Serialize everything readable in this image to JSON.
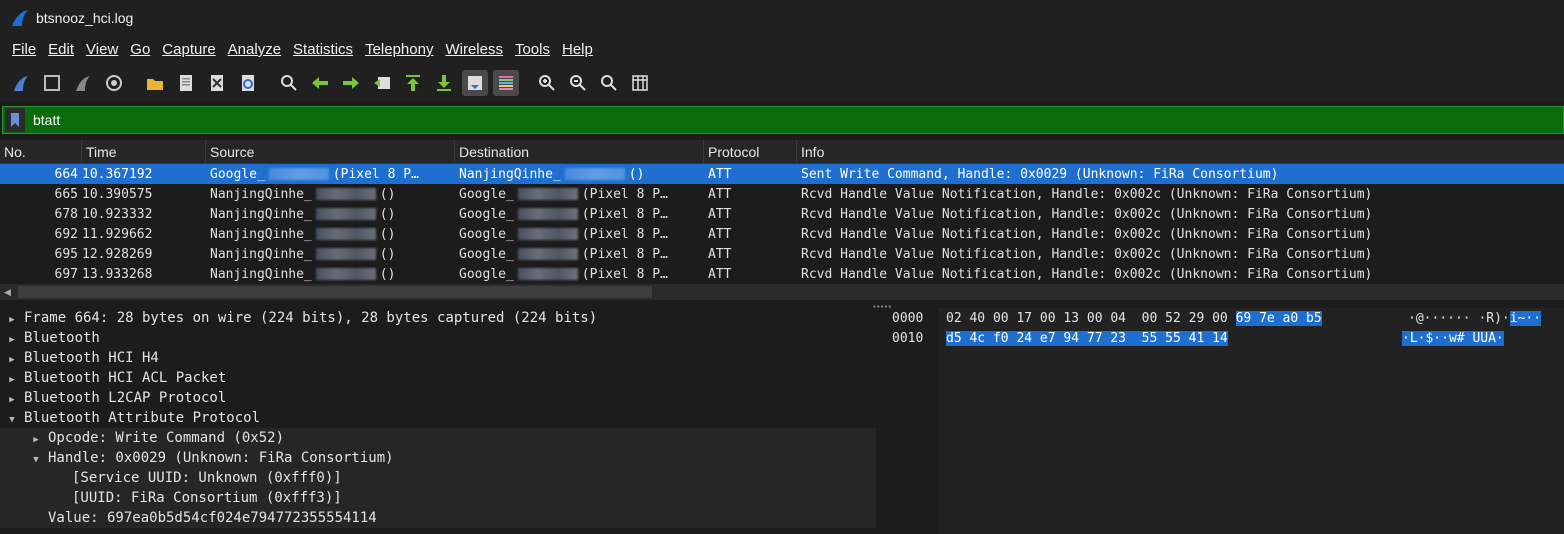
{
  "window": {
    "title": "btsnooz_hci.log"
  },
  "menu": [
    "File",
    "Edit",
    "View",
    "Go",
    "Capture",
    "Analyze",
    "Statistics",
    "Telephony",
    "Wireless",
    "Tools",
    "Help"
  ],
  "filter": {
    "value": "btatt"
  },
  "packet_list": {
    "headers": {
      "no": "No.",
      "time": "Time",
      "source": "Source",
      "destination": "Destination",
      "protocol": "Protocol",
      "info": "Info"
    },
    "rows": [
      {
        "no": "664",
        "time": "10.367192",
        "src_a": "Google_",
        "src_b": "(Pixel 8 P…",
        "dst_a": "NanjingQinhe_",
        "dst_b": "()",
        "proto": "ATT",
        "info": "Sent Write Command, Handle: 0x0029 (Unknown: FiRa Consortium)",
        "selected": true
      },
      {
        "no": "665",
        "time": "10.390575",
        "src_a": "NanjingQinhe_",
        "src_b": "()",
        "dst_a": "Google_",
        "dst_b": "(Pixel 8 P…",
        "proto": "ATT",
        "info": "Rcvd Handle Value Notification, Handle: 0x002c (Unknown: FiRa Consortium)",
        "selected": false
      },
      {
        "no": "678",
        "time": "10.923332",
        "src_a": "NanjingQinhe_",
        "src_b": "()",
        "dst_a": "Google_",
        "dst_b": "(Pixel 8 P…",
        "proto": "ATT",
        "info": "Rcvd Handle Value Notification, Handle: 0x002c (Unknown: FiRa Consortium)",
        "selected": false
      },
      {
        "no": "692",
        "time": "11.929662",
        "src_a": "NanjingQinhe_",
        "src_b": "()",
        "dst_a": "Google_",
        "dst_b": "(Pixel 8 P…",
        "proto": "ATT",
        "info": "Rcvd Handle Value Notification, Handle: 0x002c (Unknown: FiRa Consortium)",
        "selected": false
      },
      {
        "no": "695",
        "time": "12.928269",
        "src_a": "NanjingQinhe_",
        "src_b": "()",
        "dst_a": "Google_",
        "dst_b": "(Pixel 8 P…",
        "proto": "ATT",
        "info": "Rcvd Handle Value Notification, Handle: 0x002c (Unknown: FiRa Consortium)",
        "selected": false
      },
      {
        "no": "697",
        "time": "13.933268",
        "src_a": "NanjingQinhe_",
        "src_b": "()",
        "dst_a": "Google_",
        "dst_b": "(Pixel 8 P…",
        "proto": "ATT",
        "info": "Rcvd Handle Value Notification, Handle: 0x002c (Unknown: FiRa Consortium)",
        "selected": false
      }
    ]
  },
  "details": [
    {
      "text": "Frame 664: 28 bytes on wire (224 bits), 28 bytes captured (224 bits)",
      "level": 0,
      "state": "collapsed"
    },
    {
      "text": "Bluetooth",
      "level": 0,
      "state": "collapsed"
    },
    {
      "text": "Bluetooth HCI H4",
      "level": 0,
      "state": "collapsed"
    },
    {
      "text": "Bluetooth HCI ACL Packet",
      "level": 0,
      "state": "collapsed"
    },
    {
      "text": "Bluetooth L2CAP Protocol",
      "level": 0,
      "state": "collapsed"
    },
    {
      "text": "Bluetooth Attribute Protocol",
      "level": 0,
      "state": "expanded"
    },
    {
      "text": "Opcode: Write Command (0x52)",
      "level": 1,
      "state": "collapsed"
    },
    {
      "text": "Handle: 0x0029 (Unknown: FiRa Consortium)",
      "level": 1,
      "state": "expanded"
    },
    {
      "text": "[Service UUID: Unknown (0xfff0)]",
      "level": 2,
      "state": "leaf"
    },
    {
      "text": "[UUID: FiRa Consortium (0xfff3)]",
      "level": 2,
      "state": "leaf"
    },
    {
      "text": "Value: 697ea0b5d54cf024e794772355554114",
      "level": 1,
      "state": "leaf"
    }
  ],
  "bytes": {
    "rows": [
      {
        "offset": "0000",
        "hex_plain": "02 40 00 17 00 13 00 04  00 52 29 00 ",
        "hex_hl": "69 7e a0 b5",
        "ascii_plain": "·@······ ·R)·",
        "ascii_hl": "i~··"
      },
      {
        "offset": "0010",
        "hex_plain": "",
        "hex_hl": "d5 4c f0 24 e7 94 77 23  55 55 41 14",
        "ascii_plain": "",
        "ascii_hl": "·L·$··w# UUA·"
      }
    ]
  },
  "colors": {
    "selection": "#1f6fd0",
    "filter_ok": "#0a6c0a",
    "background": "#1c1c1c"
  }
}
